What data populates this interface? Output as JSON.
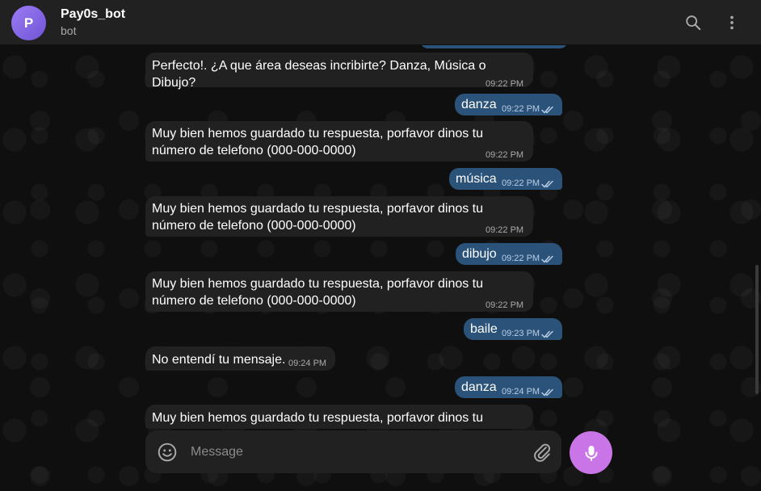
{
  "header": {
    "avatar_letter": "P",
    "title": "Pay0s_bot",
    "subtitle": "bot"
  },
  "messages": [
    {
      "dir": "in",
      "lines": [
        "Perfecto!. ¿A que área deseas incribirte? Danza, Música o Dibujo?"
      ],
      "time": "09:22 PM"
    },
    {
      "dir": "out",
      "lines": [
        "danza"
      ],
      "time": "09:22 PM"
    },
    {
      "dir": "in",
      "lines": [
        "Muy bien hemos guardado tu respuesta, porfavor dinos tu",
        "número de telefono (000-000-0000)"
      ],
      "time": "09:22 PM"
    },
    {
      "dir": "out",
      "lines": [
        "música"
      ],
      "time": "09:22 PM"
    },
    {
      "dir": "in",
      "lines": [
        "Muy bien hemos guardado tu respuesta, porfavor dinos tu",
        "número de telefono (000-000-0000)"
      ],
      "time": "09:22 PM"
    },
    {
      "dir": "out",
      "lines": [
        "dibujo"
      ],
      "time": "09:22 PM"
    },
    {
      "dir": "in",
      "lines": [
        "Muy bien hemos guardado tu respuesta, porfavor dinos tu",
        "número de telefono (000-000-0000)"
      ],
      "time": "09:22 PM"
    },
    {
      "dir": "out",
      "lines": [
        "baile"
      ],
      "time": "09:23 PM"
    },
    {
      "dir": "in",
      "lines": [
        "No entendí tu mensaje."
      ],
      "time": "09:24 PM"
    },
    {
      "dir": "out",
      "lines": [
        "danza"
      ],
      "time": "09:24 PM"
    },
    {
      "dir": "in",
      "lines": [
        "Muy bien hemos guardado tu respuesta, porfavor dinos tu"
      ],
      "time": ""
    }
  ],
  "composer": {
    "placeholder": "Message"
  },
  "icons": {
    "search": "search-icon",
    "menu": "more-vertical-icon",
    "emoji": "emoji-icon",
    "attach": "paperclip-icon",
    "mic": "microphone-icon",
    "read": "double-check-icon"
  },
  "colors": {
    "incoming_bubble": "#212121",
    "outgoing_bubble": "#2b5278",
    "accent": "#c975e8",
    "avatar": "#8a6ef0"
  }
}
